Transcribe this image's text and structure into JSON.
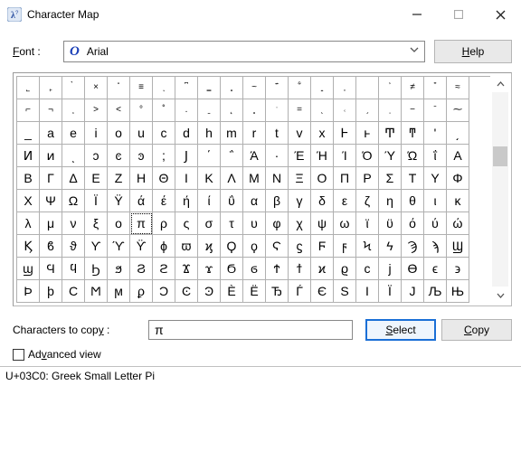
{
  "titlebar": {
    "title": "Character Map"
  },
  "font_row": {
    "label_u": "F",
    "label_rest": "ont :",
    "glyph": "O",
    "name": "Arial",
    "help_u": "H",
    "help_rest": "elp"
  },
  "grid": {
    "selected_index": 125,
    "rows": [
      [
        "˾",
        "˿",
        "̀",
        "×",
        "̎",
        "≡",
        "ͅ",
        "͆",
        "͇",
        "͈",
        "~",
        "͊",
        "͋",
        "͍",
        "͎",
        "͏",
        "͐",
        "≠",
        "͒",
        "≈"
      ],
      [
        "⌐",
        "¬",
        "͕",
        ">",
        "<",
        "°",
        "˚",
        ".",
        "ˍ",
        "˛",
        "˳",
        "ˑ",
        "=",
        "ˎ",
        "˓",
        "ˏ",
        "ˌ",
        "−",
        "ˉ",
        "⁓"
      ],
      [
        "_",
        "a",
        "e",
        "i",
        "o",
        "u",
        "c",
        "d",
        "h",
        "m",
        "r",
        "t",
        "v",
        "x",
        "Ͱ",
        "ͱ",
        "Ͳ",
        "ͳ",
        "ʹ",
        "͵"
      ],
      [
        "Ͷ",
        "ͷ",
        "ͺ",
        "ͻ",
        "ͼ",
        "ͽ",
        ";",
        "Ϳ",
        "΄",
        "΅",
        "Ά",
        "·",
        "Έ",
        "Ή",
        "Ί",
        "Ό",
        "Ύ",
        "Ώ",
        "ΐ",
        "Α"
      ],
      [
        "Β",
        "Γ",
        "Δ",
        "Ε",
        "Ζ",
        "Η",
        "Θ",
        "Ι",
        "Κ",
        "Λ",
        "Μ",
        "Ν",
        "Ξ",
        "Ο",
        "Π",
        "Ρ",
        "Σ",
        "Τ",
        "Υ",
        "Φ"
      ],
      [
        "Χ",
        "Ψ",
        "Ω",
        "Ϊ",
        "Ϋ",
        "ά",
        "έ",
        "ή",
        "ί",
        "ΰ",
        "α",
        "β",
        "γ",
        "δ",
        "ε",
        "ζ",
        "η",
        "θ",
        "ι",
        "κ"
      ],
      [
        "λ",
        "μ",
        "ν",
        "ξ",
        "ο",
        "π",
        "ρ",
        "ς",
        "σ",
        "τ",
        "υ",
        "φ",
        "χ",
        "ψ",
        "ω",
        "ϊ",
        "ϋ",
        "ό",
        "ύ",
        "ώ"
      ],
      [
        "Ϗ",
        "ϐ",
        "ϑ",
        "ϒ",
        "ϓ",
        "ϔ",
        "ϕ",
        "ϖ",
        "ϗ",
        "Ϙ",
        "ϙ",
        "Ϛ",
        "ϛ",
        "Ϝ",
        "ϝ",
        "Ϟ",
        "ϟ",
        "Ϡ",
        "ϡ",
        "Ϣ"
      ],
      [
        "ϣ",
        "Ϥ",
        "ϥ",
        "Ϧ",
        "ϧ",
        "Ϩ",
        "ϩ",
        "Ϫ",
        "ϫ",
        "Ϭ",
        "ϭ",
        "Ϯ",
        "ϯ",
        "ϰ",
        "ϱ",
        "ϲ",
        "ϳ",
        "ϴ",
        "ϵ",
        "϶"
      ],
      [
        "Ϸ",
        "ϸ",
        "Ϲ",
        "Ϻ",
        "ϻ",
        "ϼ",
        "Ͻ",
        "Ͼ",
        "Ͽ",
        "Ѐ",
        "Ё",
        "Ђ",
        "Ѓ",
        "Є",
        "Ѕ",
        "І",
        "Ї",
        "Ј",
        "Љ",
        "Њ"
      ]
    ]
  },
  "copy_row": {
    "label_pre": "Characters to cop",
    "label_u": "y",
    "label_post": " :",
    "value": "π",
    "select_u": "S",
    "select_rest": "elect",
    "copy_u": "C",
    "copy_rest": "opy"
  },
  "advanced": {
    "label_pre": "Ad",
    "label_u": "v",
    "label_post": "anced view",
    "checked": false
  },
  "status": {
    "text": "U+03C0: Greek Small Letter Pi"
  }
}
